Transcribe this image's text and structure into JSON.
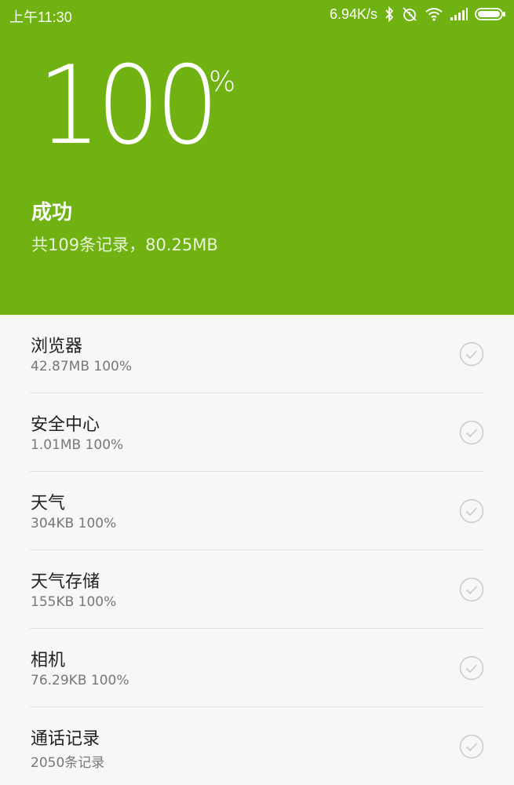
{
  "status_bar": {
    "time": "上午11:30",
    "speed": "6.94K/s",
    "icons": [
      "bluetooth-icon",
      "alarm-off-icon",
      "wifi-icon",
      "signal-icon",
      "battery-icon"
    ]
  },
  "header": {
    "percent": "100",
    "percent_sign": "%",
    "title": "成功",
    "subtitle": "共109条记录，80.25MB",
    "color": "#6fb211"
  },
  "items": [
    {
      "name": "浏览器",
      "detail": "42.87MB 100%"
    },
    {
      "name": "安全中心",
      "detail": "1.01MB 100%"
    },
    {
      "name": "天气",
      "detail": "304KB 100%"
    },
    {
      "name": "天气存储",
      "detail": "155KB 100%"
    },
    {
      "name": "相机",
      "detail": "76.29KB 100%"
    },
    {
      "name": "通话记录",
      "detail": "2050条记录"
    }
  ]
}
